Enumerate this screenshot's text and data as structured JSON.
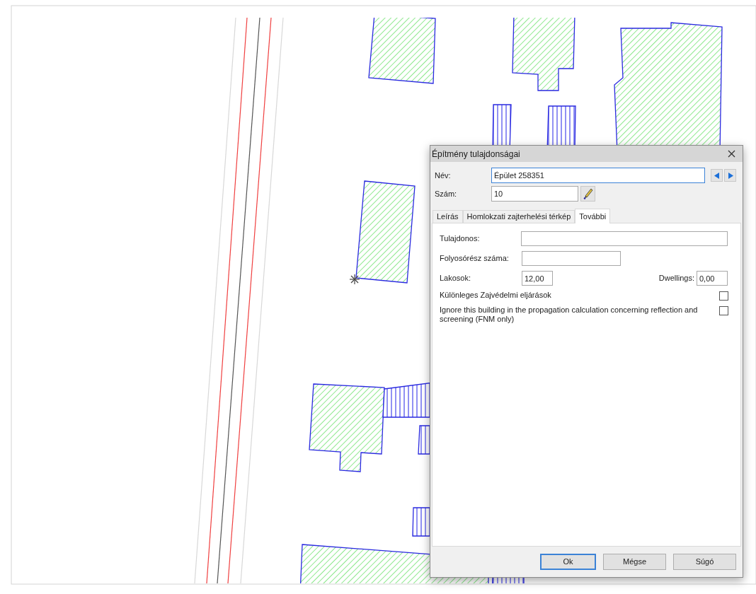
{
  "window": {
    "title": "Építmény tulajdonságai"
  },
  "name_field": {
    "label": "Név:",
    "value": "Épület 258351",
    "focused": true
  },
  "number_field": {
    "label": "Szám:",
    "value": "10"
  },
  "tabs": [
    {
      "label": "Leírás",
      "selected": false
    },
    {
      "label": "Homlokzati zajterhelési térkép",
      "selected": false
    },
    {
      "label": "További",
      "selected": true
    }
  ],
  "fields": [
    {
      "kind": "long_text",
      "label": "Tulajdonos:"
    },
    {
      "kind": "short_text",
      "label": "Folyosórész száma:"
    },
    {
      "kind": "number_pair",
      "label": "Lakosok:",
      "value": "12,00",
      "label_2": "Dwellings:",
      "value_2": "0,00"
    },
    {
      "kind": "checkbox",
      "label": "Különleges Zajvédelmi eljárások",
      "checked": false
    },
    {
      "kind": "checkbox",
      "label": "Ignore this building in the propagation calculation concerning reflection and screening (FNM only)",
      "checked": false
    }
  ],
  "buttons": [
    {
      "label": "Ok",
      "default": true
    },
    {
      "label": "Mégse",
      "default": false
    },
    {
      "label": "Súgó",
      "default": false
    }
  ]
}
